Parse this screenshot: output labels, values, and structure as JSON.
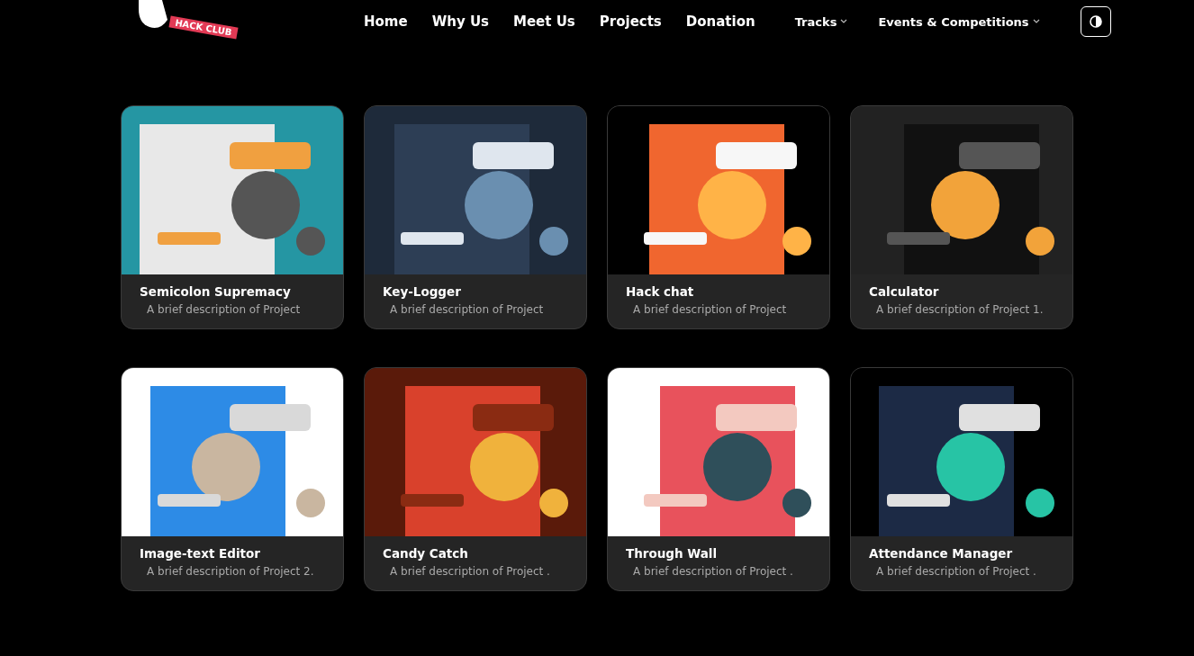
{
  "header": {
    "logo_text": "HACK CLUB",
    "nav": [
      {
        "label": "Home",
        "kind": "link"
      },
      {
        "label": "Why Us",
        "kind": "link"
      },
      {
        "label": "Meet Us",
        "kind": "link"
      },
      {
        "label": "Projects",
        "kind": "link"
      },
      {
        "label": "Donation",
        "kind": "link"
      },
      {
        "label": "Tracks",
        "kind": "dropdown"
      },
      {
        "label": "Events & Competitions",
        "kind": "dropdown"
      }
    ]
  },
  "projects": [
    {
      "title": "Semicolon Supremacy",
      "description": "A brief description of Project"
    },
    {
      "title": "Key-Logger",
      "description": "A brief description of Project"
    },
    {
      "title": "Hack chat",
      "description": "A brief description of Project"
    },
    {
      "title": "Calculator",
      "description": "A brief description of Project 1."
    },
    {
      "title": "Image-text Editor",
      "description": "A brief description of Project 2."
    },
    {
      "title": "Candy Catch",
      "description": "A brief description of Project ."
    },
    {
      "title": "Through Wall",
      "description": "A brief description of Project ."
    },
    {
      "title": "Attendance Manager",
      "description": "A brief description of Project ."
    }
  ]
}
